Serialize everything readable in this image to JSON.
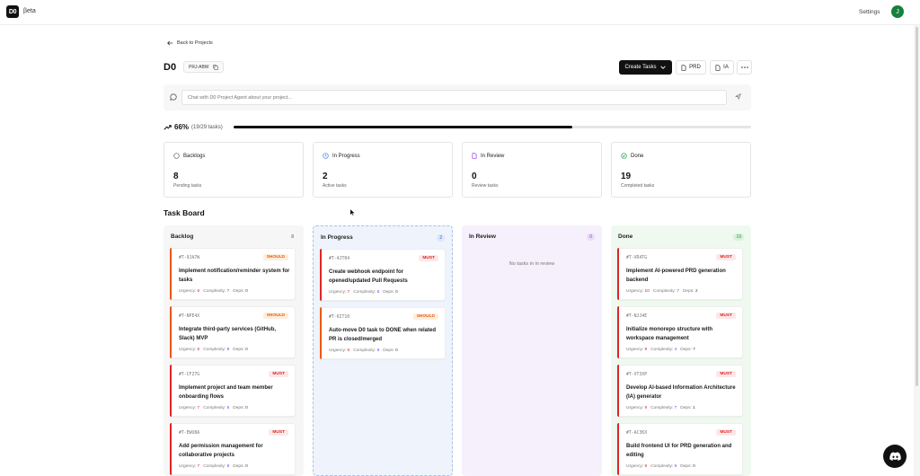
{
  "app": {
    "logo": "D0",
    "badge": "βeta",
    "settings": "Settings",
    "avatar_initial": "J"
  },
  "nav": {
    "back": "Back to Projects"
  },
  "project": {
    "name": "D0",
    "id": "PRJ-ABW",
    "create_label": "Create Tasks",
    "prd_label": "PRD",
    "ia_label": "IA"
  },
  "chat": {
    "placeholder": "Chat with D0 Project Agent about your project..."
  },
  "progress": {
    "percent_label": "66%",
    "detail": "(19/29 tasks)",
    "fraction": 0.655
  },
  "stats": [
    {
      "label": "Backlogs",
      "count": "8",
      "sub": "Pending tasks"
    },
    {
      "label": "In Progress",
      "count": "2",
      "sub": "Active tasks"
    },
    {
      "label": "In Review",
      "count": "0",
      "sub": "Review tasks"
    },
    {
      "label": "Done",
      "count": "19",
      "sub": "Completed tasks"
    }
  ],
  "board": {
    "title": "Task Board",
    "columns": [
      {
        "name": "Backlog",
        "count": "8"
      },
      {
        "name": "In Progress",
        "count": "2"
      },
      {
        "name": "In Review",
        "count": "0",
        "empty": "No tasks in in review"
      },
      {
        "name": "Done",
        "count": "19"
      }
    ],
    "meta_labels": {
      "urgency": "Urgency:",
      "complexity": "Complexity:",
      "deps": "Deps:"
    },
    "backlog": [
      {
        "id": "#T-9JA7W",
        "priority": "SHOULD",
        "title": "Implement notification/reminder system for tasks",
        "urgency": "6",
        "complexity": "7",
        "deps": "0"
      },
      {
        "id": "#T-NPE4X",
        "priority": "SHOULD",
        "title": "Integrate third-party services (GitHub, Slack) MVP",
        "urgency": "6",
        "complexity": "8",
        "deps": "0"
      },
      {
        "id": "#T-CFZ7G",
        "priority": "MUST",
        "title": "Implement project and team member onboarding flows",
        "urgency": "7",
        "complexity": "5",
        "deps": "0"
      },
      {
        "id": "#T-EWU8A",
        "priority": "MUST",
        "title": "Add permission management for collaborative projects",
        "urgency": "7",
        "complexity": "8",
        "deps": "0"
      }
    ],
    "in_progress": [
      {
        "id": "#T-4JT04",
        "priority": "MUST",
        "title": "Create webhook endpoint for opened/updated Pull Requests",
        "urgency": "7",
        "complexity": "5",
        "deps": "0"
      },
      {
        "id": "#T-6IT10",
        "priority": "SHOULD",
        "title": "Auto-move D0 task to DONE when related PR is closed/merged",
        "urgency": "6",
        "complexity": "6",
        "deps": "0"
      }
    ],
    "done": [
      {
        "id": "#T-VR4TG",
        "priority": "MUST",
        "title": "Implement AI-powered PRD generation backend",
        "urgency": "10",
        "complexity": "7",
        "deps": "2"
      },
      {
        "id": "#T-NJJ4E",
        "priority": "MUST",
        "title": "Initialize monorepo structure with workspace management",
        "urgency": "9",
        "complexity": "4",
        "deps": "7"
      },
      {
        "id": "#T-VT3XP",
        "priority": "MUST",
        "title": "Develop AI-based Information Architecture (IA) generator",
        "urgency": "9",
        "complexity": "7",
        "deps": "1"
      },
      {
        "id": "#T-AC3KX",
        "priority": "MUST",
        "title": "Build frontend UI for PRD generation and editing",
        "urgency": "9",
        "complexity": "6",
        "deps": "0"
      }
    ]
  },
  "colors": {
    "must": "#dc2626",
    "should": "#ea580c",
    "primary": "#111111",
    "done": "#16a34a",
    "review": "#9333ea",
    "progress": "#3b82f6"
  }
}
